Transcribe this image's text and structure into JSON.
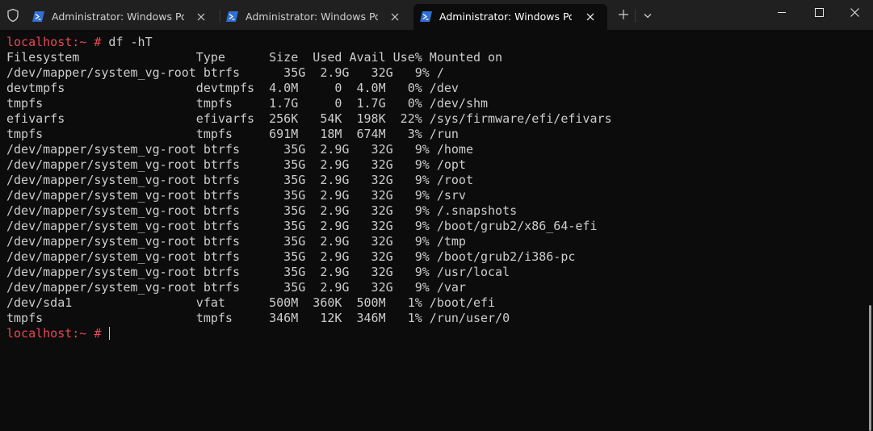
{
  "tabs": [
    {
      "label": "Administrator: Windows PowerShell",
      "icon": "powershell-icon",
      "active": false
    },
    {
      "label": "Administrator: Windows PowerShell",
      "icon": "powershell-icon",
      "active": false
    },
    {
      "label": "Administrator: Windows PowerShell",
      "icon": "powershell-icon",
      "active": true
    }
  ],
  "titlebar_icons": {
    "shield": "shield-icon",
    "new_tab": "plus-icon",
    "dropdown": "chevron-down-icon",
    "minimize": "minimize-icon",
    "maximize": "maximize-icon",
    "close": "close-icon"
  },
  "colors": {
    "background": "#0c0c0c",
    "titlebar": "#202020",
    "prompt": "#e74856",
    "text": "#cccccc"
  },
  "terminal": {
    "prompt": "localhost:~ #",
    "command": " df -hT",
    "output": [
      "Filesystem                Type      Size  Used Avail Use% Mounted on",
      "/dev/mapper/system_vg-root btrfs      35G  2.9G   32G   9% /",
      "devtmpfs                  devtmpfs  4.0M     0  4.0M   0% /dev",
      "tmpfs                     tmpfs     1.7G     0  1.7G   0% /dev/shm",
      "efivarfs                  efivarfs  256K   54K  198K  22% /sys/firmware/efi/efivars",
      "tmpfs                     tmpfs     691M   18M  674M   3% /run",
      "/dev/mapper/system_vg-root btrfs      35G  2.9G   32G   9% /home",
      "/dev/mapper/system_vg-root btrfs      35G  2.9G   32G   9% /opt",
      "/dev/mapper/system_vg-root btrfs      35G  2.9G   32G   9% /root",
      "/dev/mapper/system_vg-root btrfs      35G  2.9G   32G   9% /srv",
      "/dev/mapper/system_vg-root btrfs      35G  2.9G   32G   9% /.snapshots",
      "/dev/mapper/system_vg-root btrfs      35G  2.9G   32G   9% /boot/grub2/x86_64-efi",
      "/dev/mapper/system_vg-root btrfs      35G  2.9G   32G   9% /tmp",
      "/dev/mapper/system_vg-root btrfs      35G  2.9G   32G   9% /boot/grub2/i386-pc",
      "/dev/mapper/system_vg-root btrfs      35G  2.9G   32G   9% /usr/local",
      "/dev/mapper/system_vg-root btrfs      35G  2.9G   32G   9% /var",
      "/dev/sda1                 vfat      500M  360K  500M   1% /boot/efi",
      "tmpfs                     tmpfs     346M   12K  346M   1% /run/user/0"
    ],
    "final_prompt": "localhost:~ #"
  }
}
